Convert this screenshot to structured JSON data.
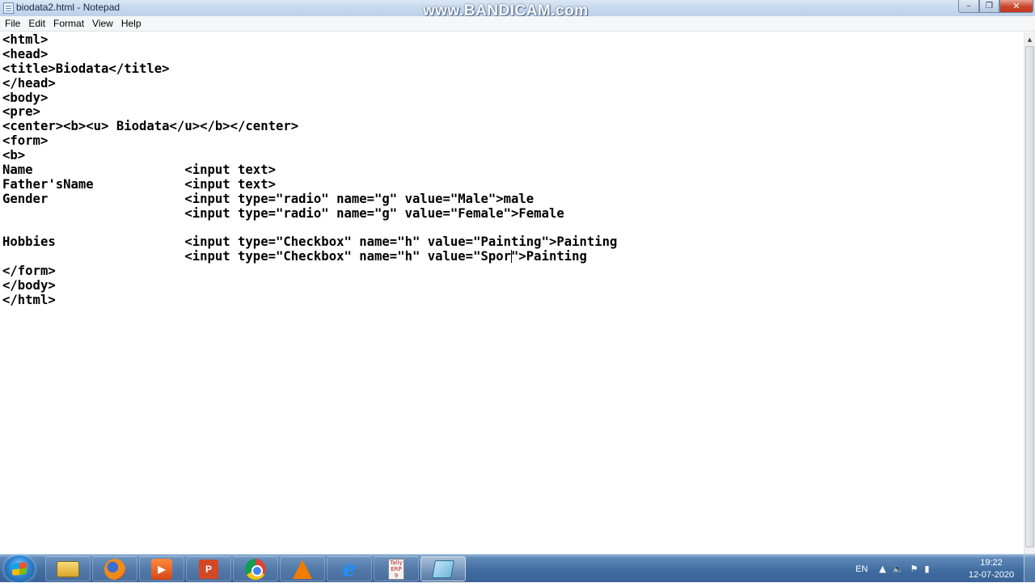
{
  "window": {
    "title": "biodata2.html - Notepad",
    "watermark": "www.BANDICAM.com",
    "min_glyph": "–",
    "max_glyph": "❐",
    "close_glyph": "✕"
  },
  "menu": [
    "File",
    "Edit",
    "Format",
    "View",
    "Help"
  ],
  "editor": {
    "lines": [
      "<html>",
      "<head>",
      "<title>Biodata</title>",
      "</head>",
      "<body>",
      "<pre>",
      "<center><b><u> Biodata</u></b></center>",
      "<form>",
      "<b>",
      "Name                    <input text>",
      "Father'sName            <input text>",
      "Gender                  <input type=\"radio\" name=\"g\" value=\"Male\">male",
      "                        <input type=\"radio\" name=\"g\" value=\"Female\">Female",
      "",
      "Hobbies                 <input type=\"Checkbox\" name=\"h\" value=\"Painting\">Painting",
      "                        <input type=\"Checkbox\" name=\"h\" value=\"Spor\">Painting",
      "</form>",
      "</body>",
      "</html>"
    ],
    "caret": {
      "line": 15,
      "column": 67
    }
  },
  "taskbar": {
    "apps": [
      {
        "name": "windows-explorer",
        "icon": "folder-icon",
        "label": ""
      },
      {
        "name": "firefox",
        "icon": "firefox-icon",
        "label": ""
      },
      {
        "name": "media-player",
        "icon": "media-player-icon",
        "label": "▶"
      },
      {
        "name": "powerpoint",
        "icon": "powerpoint-icon",
        "label": "P"
      },
      {
        "name": "chrome",
        "icon": "chrome-icon",
        "label": ""
      },
      {
        "name": "vlc",
        "icon": "vlc-icon",
        "label": ""
      },
      {
        "name": "internet-explorer",
        "icon": "internet-explorer-icon",
        "label": "e"
      },
      {
        "name": "tally-erp",
        "icon": "tally-icon",
        "label": "Tally ERP 9"
      },
      {
        "name": "notepad",
        "icon": "notepad-icon",
        "label": ""
      }
    ],
    "tray": {
      "language": "EN",
      "clock_time": "19:22",
      "clock_date": "12-07-2020"
    }
  },
  "colors": {
    "taskbar": "#3f6b9f",
    "titlebar": "#c7d9ee",
    "close_button": "#c9442a"
  }
}
